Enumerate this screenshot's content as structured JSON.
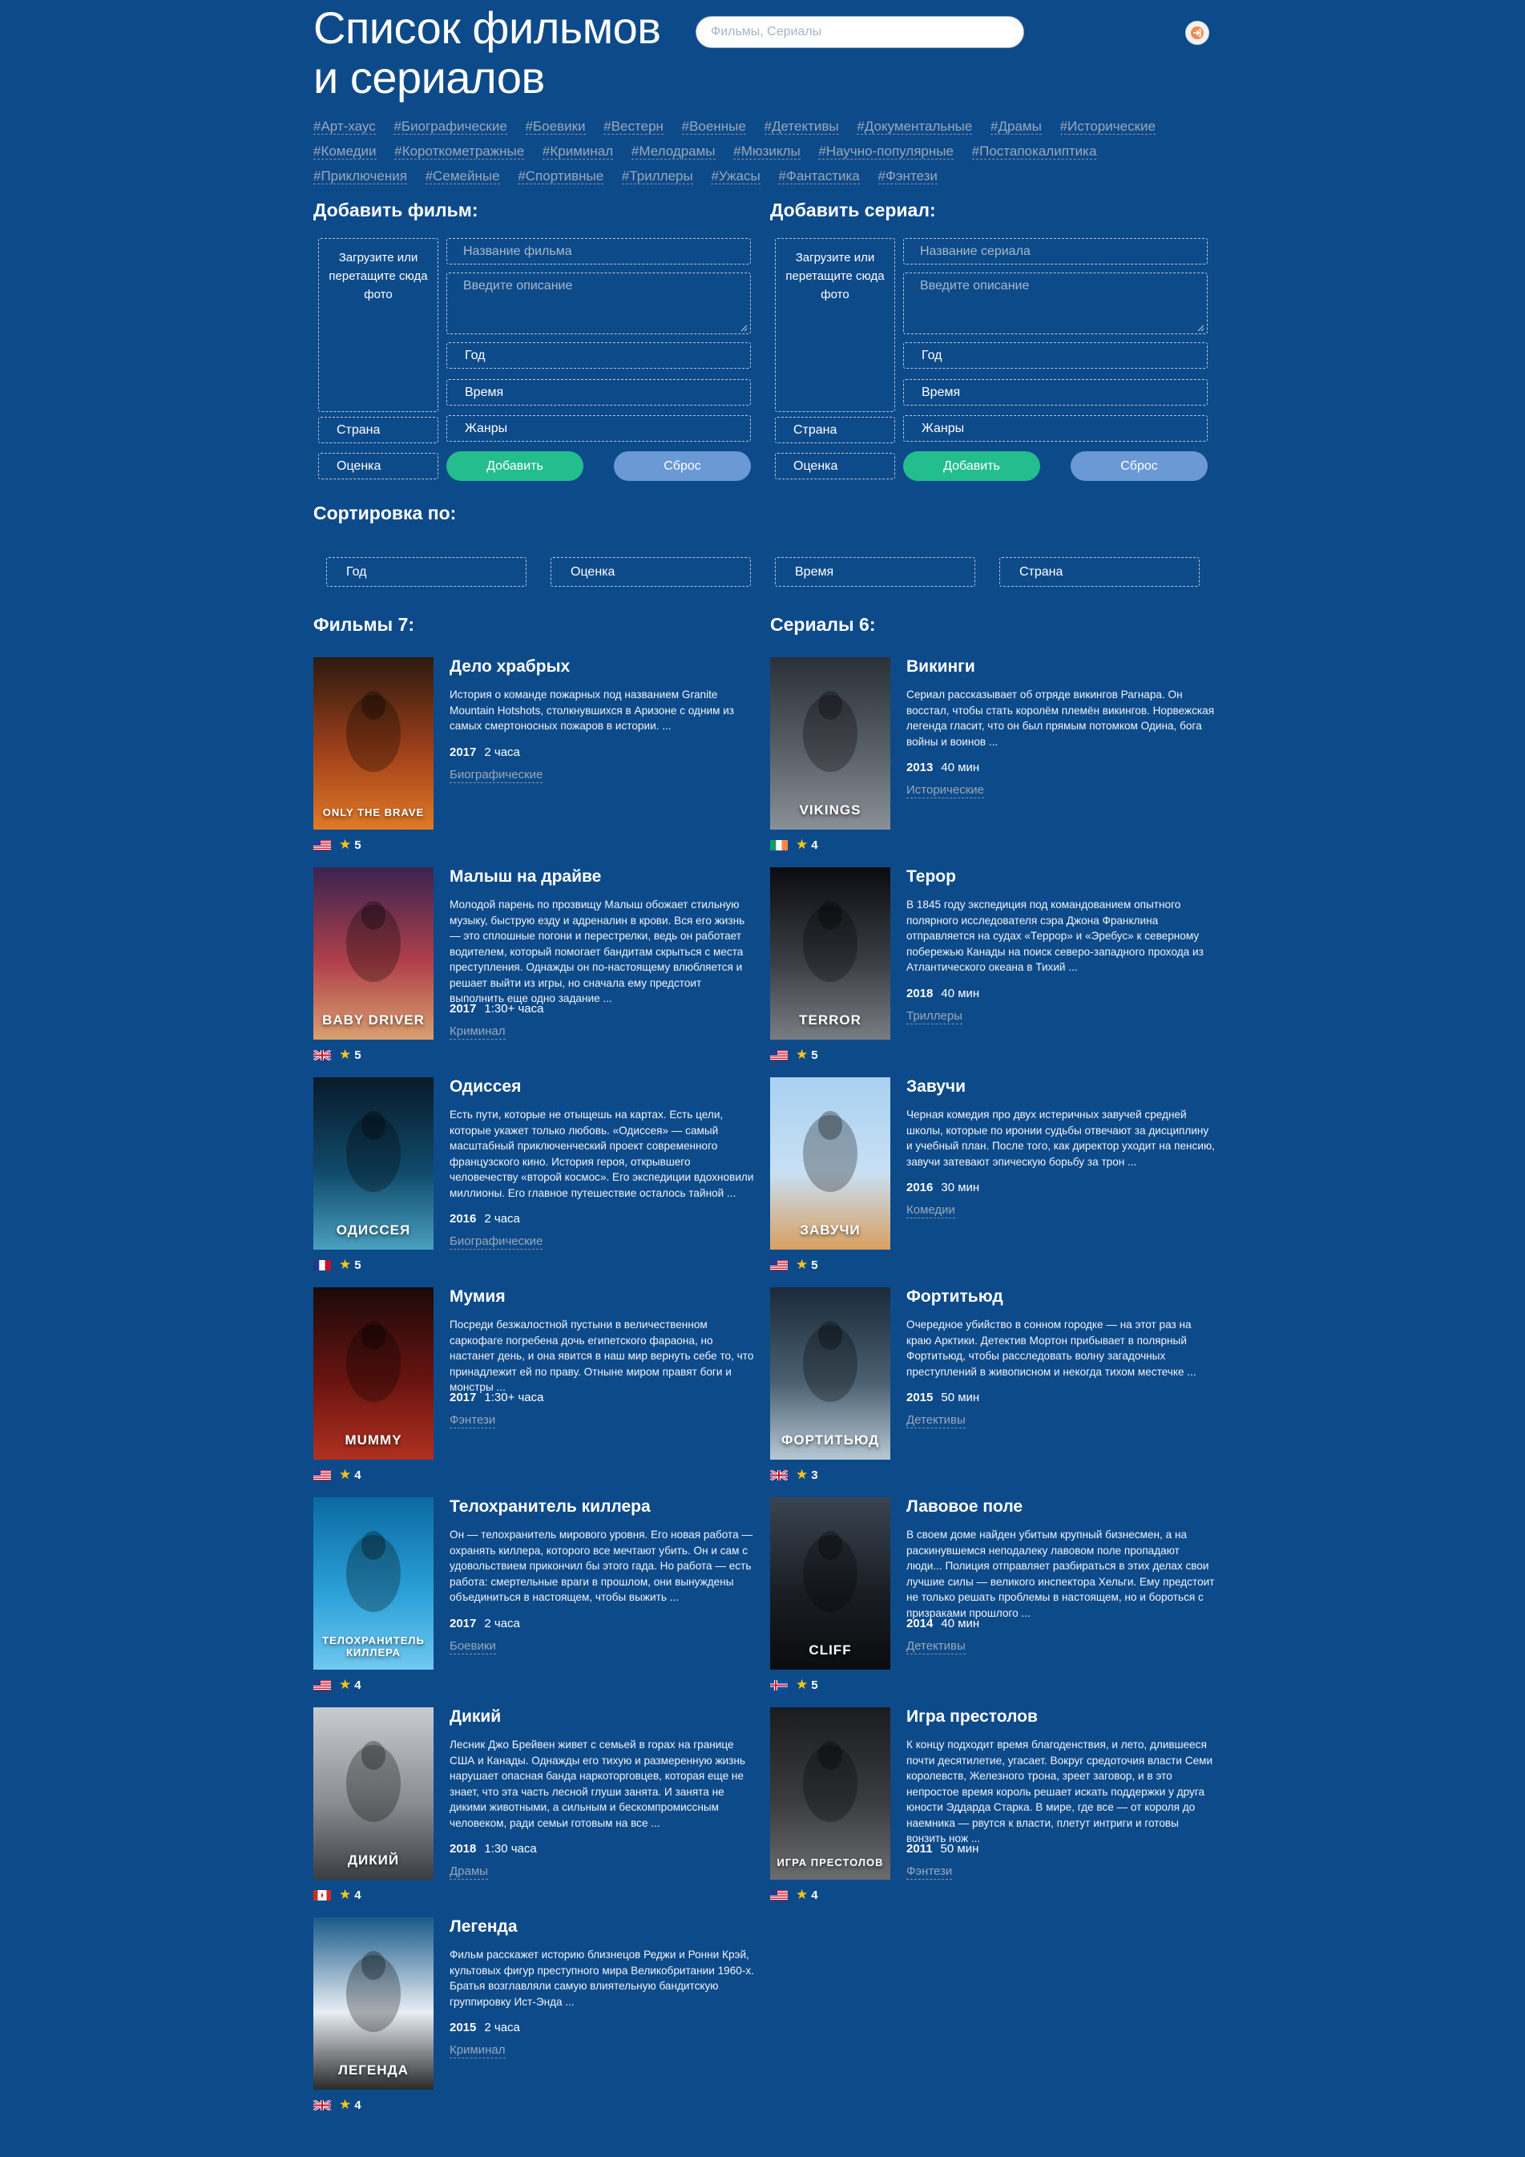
{
  "header": {
    "title_line1": "Список фильмов",
    "title_line2": "и сериалов",
    "search_placeholder": "Фильмы, Сериалы",
    "login_icon": "sign-in-icon"
  },
  "tags": [
    "#Арт-хаус",
    "#Биографические",
    "#Боевики",
    "#Вестерн",
    "#Военные",
    "#Детективы",
    "#Документальные",
    "#Драмы",
    "#Исторические",
    "#Комедии",
    "#Короткометражные",
    "#Криминал",
    "#Мелодрамы",
    "#Мюзиклы",
    "#Научно-популярные",
    "#Постапокалиптика",
    "#Приключения",
    "#Семейные",
    "#Спортивные",
    "#Триллеры",
    "#Ужасы",
    "#Фантастика",
    "#Фэнтези"
  ],
  "add_film": {
    "heading": "Добавить фильм:",
    "photo_text": "Загрузите или перетащите сюда фото",
    "name_placeholder": "Название фильма",
    "desc_placeholder": "Введите описание",
    "year": "Год",
    "time": "Время",
    "genres": "Жанры",
    "country": "Страна",
    "rating": "Оценка",
    "add_label": "Добавить",
    "reset_label": "Сброс"
  },
  "add_series": {
    "heading": "Добавить сериал:",
    "photo_text": "Загрузите или перетащите сюда фото",
    "name_placeholder": "Название сериала",
    "desc_placeholder": "Введите описание",
    "year": "Год",
    "time": "Время",
    "genres": "Жанры",
    "country": "Страна",
    "rating": "Оценка",
    "add_label": "Добавить",
    "reset_label": "Сброс"
  },
  "sort": {
    "heading": "Сортировка по:",
    "options": [
      "Год",
      "Оценка",
      "Время",
      "Страна"
    ]
  },
  "films": {
    "heading": "Фильмы 7:",
    "items": [
      {
        "title": "Дело храбрых",
        "desc": "История о команде пожарных под названием Granite Mountain Hotshots, столкнувшихся в Аризоне с одним из самых смертоносных пожаров в истории. ...",
        "year": "2017",
        "duration": "2 часа",
        "genre": "Биографические",
        "flag": "us",
        "rating": "5",
        "poster_text": "ONLY THE BRAVE",
        "poster_colors": [
          "#2b1a10",
          "#a0401a",
          "#e07a26"
        ]
      },
      {
        "title": "Малыш на драйве",
        "desc": "Молодой парень по прозвищу Малыш обожает стильную музыку, быструю езду и адреналин в крови. Вся его жизнь — это сплошные погони и перестрелки, ведь он работает водителем, который помогает бандитам скрыться с места преступления. Однажды он по-настоящему влюбляется и решает выйти из игры, но сначала ему предстоит выполнить еще одно задание ...",
        "year": "2017",
        "duration": "1:30+ часа",
        "genre": "Криминал",
        "flag": "uk",
        "rating": "5",
        "poster_text": "BABY DRIVER",
        "poster_colors": [
          "#3a2350",
          "#b0404a",
          "#d9a070"
        ]
      },
      {
        "title": "Одиссея",
        "desc": "Есть пути, которые не отыщешь на картах. Есть цели, которые укажет только любовь. «Одиссея» — самый масштабный приключенческий проект современного французского кино. История героя, открывшего человечеству «второй космос». Его экспедиции вдохновили миллионы. Его главное путешествие осталось тайной ...",
        "year": "2016",
        "duration": "2 часа",
        "genre": "Биографические",
        "flag": "fr",
        "rating": "5",
        "poster_text": "ОДИССЕЯ",
        "poster_colors": [
          "#0a1a2a",
          "#0f4a6a",
          "#4aa0c0"
        ]
      },
      {
        "title": "Мумия",
        "desc": "Посреди безжалостной пустыни в величественном саркофаге погребена дочь египетского фараона, но настанет день, и она явится в наш мир вернуть себе то, что принадлежит ей по праву. Отныне миром правят боги и монстры ...",
        "year": "2017",
        "duration": "1:30+ часа",
        "genre": "Фэнтези",
        "flag": "us",
        "rating": "4",
        "poster_text": "MUMMY",
        "poster_colors": [
          "#1a0a0a",
          "#6a1410",
          "#b03020"
        ]
      },
      {
        "title": "Телохранитель киллера",
        "desc": "Он — телохранитель мирового уровня. Его новая работа — охранять киллера, которого все мечтают убить. Он и сам с удовольствием прикончил бы этого гада. Но работа — есть работа: смертельные враги в прошлом, они вынуждены объединиться в настоящем, чтобы выжить ...",
        "year": "2017",
        "duration": "2 часа",
        "genre": "Боевики",
        "flag": "us",
        "rating": "4",
        "poster_text": "ТЕЛОХРАНИТЕЛЬ КИЛЛЕРА",
        "poster_colors": [
          "#0a6aa0",
          "#2aa0d8",
          "#70c8f0"
        ]
      },
      {
        "title": "Дикий",
        "desc": "Лесник Джо Брейвен живет с семьей в горах на границе США и Канады. Однажды его тихую и размеренную жизнь нарушает опасная банда наркоторговцев, которая еще не знает, что эта часть лесной глуши занята. И занята не дикими животными, а сильным и бескомпромиссным человеком, ради семьи готовым на все ...",
        "year": "2018",
        "duration": "1:30 часа",
        "genre": "Драмы",
        "flag": "ca",
        "rating": "4",
        "poster_text": "ДИКИЙ",
        "poster_colors": [
          "#c8ccd0",
          "#8a8e92",
          "#3a3e42"
        ]
      },
      {
        "title": "Легенда",
        "desc": "Фильм расскажет историю близнецов Реджи и Ронни Крэй, культовых фигур преступного мира Великобритании 1960-х. Братья возглавляли самую влиятельную бандитскую группировку Ист-Энда ...",
        "year": "2015",
        "duration": "2 часа",
        "genre": "Криминал",
        "flag": "uk",
        "rating": "4",
        "poster_text": "ЛЕГЕНДА",
        "poster_colors": [
          "#1a5a8a",
          "#e8eef4",
          "#2a2a2a"
        ]
      }
    ]
  },
  "series": {
    "heading": "Сериалы 6:",
    "items": [
      {
        "title": "Викинги",
        "desc": "Сериал рассказывает об отряде викингов Рагнара. Он восстал, чтобы стать королём племён викингов. Норвежская легенда гласит, что он был прямым потомком Одина, бога войны и воинов ...",
        "year": "2013",
        "duration": "40 мин",
        "genre": "Исторические",
        "flag": "ie",
        "rating": "4",
        "poster_text": "VIKINGS",
        "poster_colors": [
          "#2a3038",
          "#5a6068",
          "#8a9098"
        ]
      },
      {
        "title": "Терор",
        "desc": "В 1845 году экспедиция под командованием опытного полярного исследователя сэра Джона Франклина отправляется на судах «Террор» и «Эребус» к северному побережью Канады на поиск северо-западного прохода из Атлантического океана в Тихий ...",
        "year": "2018",
        "duration": "40 мин",
        "genre": "Триллеры",
        "flag": "us",
        "rating": "5",
        "poster_text": "TERROR",
        "poster_colors": [
          "#0a0c10",
          "#3a3e44",
          "#7a7e84"
        ]
      },
      {
        "title": "Завучи",
        "desc": "Черная комедия про двух истеричных завучей средней школы, которые по иронии судьбы отвечают за дисциплину и учебный план. После того, как директор уходит на пенсию, завучи затевают эпическую борьбу за трон ...",
        "year": "2016",
        "duration": "30 мин",
        "genre": "Комедии",
        "flag": "us",
        "rating": "5",
        "poster_text": "ЗАВУЧИ",
        "poster_colors": [
          "#a8d0f0",
          "#c8e0f4",
          "#d8a060"
        ]
      },
      {
        "title": "Фортитьюд",
        "desc": "Очередное убийство в сонном городке — на этот раз на краю Арктики. Детектив Мортон прибывает в полярный Фортитьюд, чтобы расследовать волну загадочных преступлений в живописном и некогда тихом местечке ...",
        "year": "2015",
        "duration": "50 мин",
        "genre": "Детективы",
        "flag": "uk",
        "rating": "3",
        "poster_text": "ФОРТИТЬЮД",
        "poster_colors": [
          "#1a2a3a",
          "#4a6070",
          "#b8c8d4"
        ]
      },
      {
        "title": "Лавовое поле",
        "desc": "В своем доме найден убитым крупный бизнесмен, а на раскинувшемся неподалеку лавовом поле пропадают люди... Полиция отправляет разбираться в этих делах свои лучшие силы — великого инспектора Хельги. Ему предстоит не только решать проблемы в настоящем, но и бороться с призраками прошлого ...",
        "year": "2014",
        "duration": "40 мин",
        "genre": "Детективы",
        "flag": "is",
        "rating": "5",
        "poster_text": "CLIFF",
        "poster_colors": [
          "#3a4450",
          "#1a1e24",
          "#0a0c0e"
        ]
      },
      {
        "title": "Игра престолов",
        "desc": "К концу подходит время благоденствия, и лето, длившееся почти десятилетие, угасает. Вокруг средоточия власти Семи королевств, Железного трона, зреет заговор, и в это непростое время король решает искать поддержки у друга юности Эддарда Старка. В мире, где все — от короля до наемника — рвутся к власти, плетут интриги и готовы вонзить нож ...",
        "year": "2011",
        "duration": "50 мин",
        "genre": "Фэнтези",
        "flag": "us",
        "rating": "4",
        "poster_text": "ИГРА ПРЕСТОЛОВ",
        "poster_colors": [
          "#1a1c1e",
          "#3a3c3e",
          "#6a6c6e"
        ]
      }
    ]
  }
}
